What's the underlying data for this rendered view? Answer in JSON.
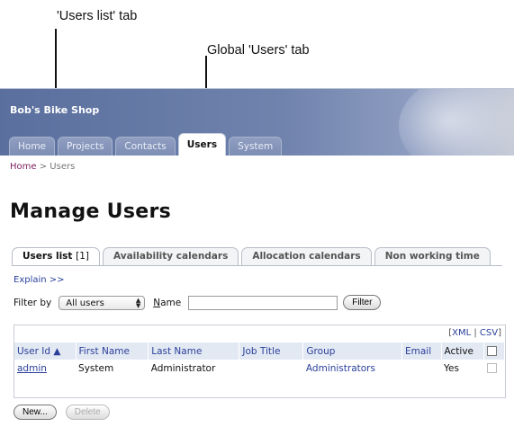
{
  "callouts": {
    "users_list_tab": "'Users list' tab",
    "global_users_tab": "Global 'Users' tab"
  },
  "app": {
    "brand": "Bob's Bike Shop",
    "nav_tabs": [
      "Home",
      "Projects",
      "Contacts",
      "Users",
      "System"
    ],
    "active_nav": "Users",
    "breadcrumb": {
      "home": "Home",
      "separator": ">",
      "current": "Users"
    },
    "page_title": "Manage Users"
  },
  "subtabs": [
    {
      "label": "Users list",
      "count": "[1]"
    },
    {
      "label": "Availability calendars"
    },
    {
      "label": "Allocation calendars"
    },
    {
      "label": "Non working time"
    }
  ],
  "explain_link": "Explain >>",
  "filter": {
    "label": "Filter by",
    "selected": "All users",
    "name_label_first": "N",
    "name_label_rest": "ame",
    "name_value": "",
    "button": "Filter"
  },
  "export": {
    "open": "[",
    "xml": "XML",
    "sep": "|",
    "csv": "CSV",
    "close": "]"
  },
  "table": {
    "columns": [
      "User Id ▲",
      "First Name",
      "Last Name",
      "Job Title",
      "Group",
      "Email",
      "Active"
    ],
    "rows": [
      {
        "user_id": "admin",
        "first_name": "System",
        "last_name": "Administrator",
        "job_title": "",
        "group": "Administrators",
        "email": "",
        "active": "Yes"
      }
    ]
  },
  "actions": {
    "new": "New...",
    "delete": "Delete"
  },
  "colors": {
    "accent": "#2a3f9a",
    "banner": "#6f82ad",
    "crumb_link": "#7a1e5e"
  }
}
